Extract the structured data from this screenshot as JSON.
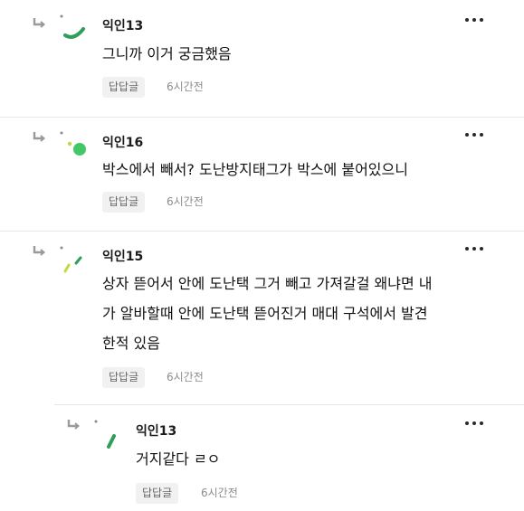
{
  "comments": [
    {
      "author": "익인13",
      "lines": [
        "그니까 이거 궁금했음"
      ],
      "reply_label": "답답글",
      "time": "6시간전",
      "accent": "#2f9e5a",
      "avatar_icon": "arc-avatar-icon"
    },
    {
      "author": "익인16",
      "lines": [
        "박스에서 빼서? 도난방지태그가 박스에 붙어있으니"
      ],
      "reply_label": "답답글",
      "time": "6시간전",
      "accent": "#44c766",
      "avatar_icon": "dots-avatar-icon"
    },
    {
      "author": "익인15",
      "lines": [
        "상자 뜯어서 안에 도난택 그거 빼고 가져갈걸 왜냐면 내",
        "가 알바할때 안에 도난택 뜯어진거 매대 구석에서 발견",
        "한적 있음"
      ],
      "reply_label": "답답글",
      "time": "6시간전",
      "accent": "#c6d93a",
      "avatar_icon": "dashes-avatar-icon"
    },
    {
      "author": "익인13",
      "lines": [
        "거지같다 ㄹㅇ"
      ],
      "reply_label": "답답글",
      "time": "6시간전",
      "accent": "#2f9e5a",
      "avatar_icon": "bar-avatar-icon"
    }
  ],
  "icons": {
    "reply_arrow": "reply-arrow-icon",
    "more": "more-options-icon"
  }
}
